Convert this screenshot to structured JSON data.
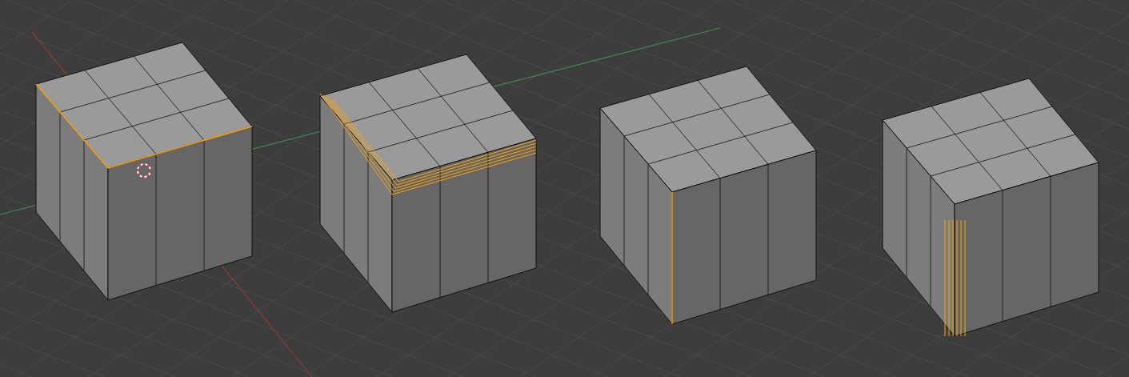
{
  "viewport": {
    "cubes": [
      {
        "kind": "edges-selected",
        "cursor": true
      },
      {
        "kind": "bevel-selected",
        "cursor": false
      },
      {
        "kind": "edge-selected",
        "cursor": false
      },
      {
        "kind": "corner-selected",
        "cursor": false
      }
    ]
  }
}
